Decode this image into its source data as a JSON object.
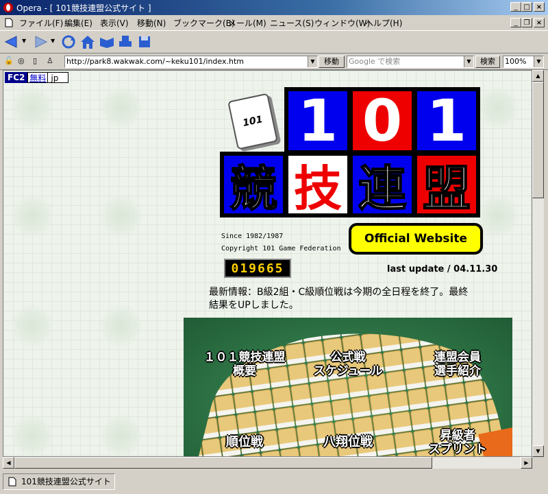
{
  "window": {
    "title": "Opera - [ 101競技連盟公式サイト ]",
    "minimize": "_",
    "maximize": "□",
    "close": "×",
    "restore": "❐"
  },
  "menu": {
    "items": [
      "ファイル(F)",
      "編集(E)",
      "表示(V)",
      "移動(N)",
      "ブックマーク(B)",
      "メール(M)",
      "ニュース(S)",
      "ウィンドウ(W)",
      "ヘルプ(H)"
    ]
  },
  "toolbar": {
    "icons": [
      "back-icon",
      "forward-icon",
      "reload-icon",
      "home-icon",
      "hotlist-icon",
      "print-icon"
    ]
  },
  "address": {
    "url": "http://park8.wakwak.com/~keku101/index.htm",
    "go_label": "移動",
    "search_placeholder": "Google で検索",
    "search_label": "検索",
    "zoom": "100%"
  },
  "ad": {
    "fc2": "FC2",
    "free": "無料",
    "jp": "jp"
  },
  "page": {
    "logo_tile_text": "101",
    "digits": [
      "1",
      "0",
      "1"
    ],
    "kanji": [
      "競",
      "技",
      "連",
      "盟"
    ],
    "since": "Since 1982/1987",
    "copyright": "Copyright 101 Game Federation",
    "official": "Official Website",
    "counter": "019665",
    "last_update": "last update / 04.11.30",
    "news_line1": "最新情報：B級2組・C級順位戦は今期の全日程を終了。最終",
    "news_line2": "結果をUPしました。",
    "menu_items": [
      {
        "l1": "１０１競技連盟",
        "l2": "概要"
      },
      {
        "l1": "公式戦",
        "l2": "スケジュール"
      },
      {
        "l1": "連盟会員",
        "l2": "選手紹介"
      },
      {
        "l1": "順位戦",
        "l2": ""
      },
      {
        "l1": "八翔位戦",
        "l2": ""
      },
      {
        "l1": "昇級者",
        "l2": "スプリント"
      }
    ]
  },
  "status": {
    "text": "101競技連盟公式サイト"
  },
  "colors": {
    "blue": "#0000ee",
    "red": "#ee0000",
    "yellow": "#ffff00",
    "felt": "#2e7d4a"
  }
}
